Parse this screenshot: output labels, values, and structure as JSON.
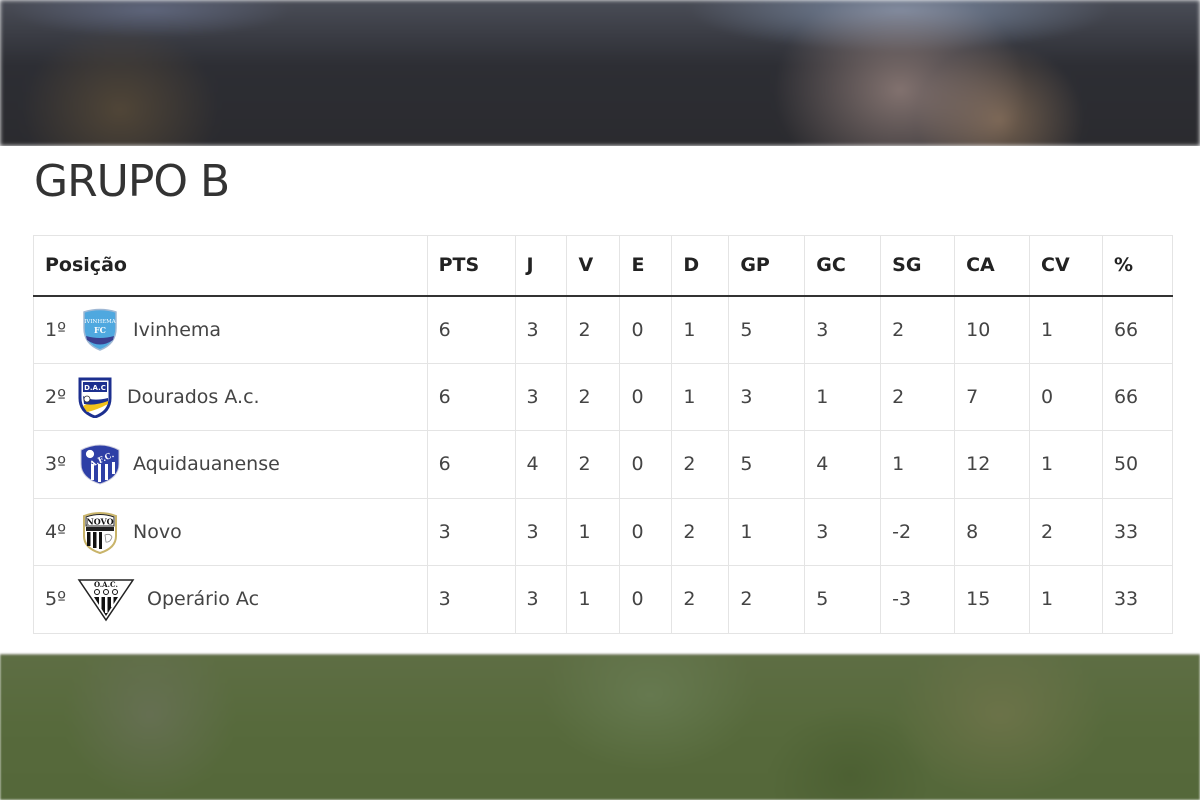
{
  "page": {
    "title": "GRUPO B"
  },
  "table": {
    "headers": [
      "Posição",
      "PTS",
      "J",
      "V",
      "E",
      "D",
      "GP",
      "GC",
      "SG",
      "CA",
      "CV",
      "%"
    ],
    "rows": [
      {
        "position": "1º",
        "crest": "ivinhema-crest-icon",
        "team": "Ivinhema",
        "pts": "6",
        "j": "3",
        "v": "2",
        "e": "0",
        "d": "1",
        "gp": "5",
        "gc": "3",
        "sg": "2",
        "ca": "10",
        "cv": "1",
        "pct": "66"
      },
      {
        "position": "2º",
        "crest": "dourados-crest-icon",
        "team": "Dourados A.c.",
        "pts": "6",
        "j": "3",
        "v": "2",
        "e": "0",
        "d": "1",
        "gp": "3",
        "gc": "1",
        "sg": "2",
        "ca": "7",
        "cv": "0",
        "pct": "66"
      },
      {
        "position": "3º",
        "crest": "aquidauanense-crest-icon",
        "team": "Aquidauanense",
        "pts": "6",
        "j": "4",
        "v": "2",
        "e": "0",
        "d": "2",
        "gp": "5",
        "gc": "4",
        "sg": "1",
        "ca": "12",
        "cv": "1",
        "pct": "50"
      },
      {
        "position": "4º",
        "crest": "novo-crest-icon",
        "team": "Novo",
        "pts": "3",
        "j": "3",
        "v": "1",
        "e": "0",
        "d": "2",
        "gp": "1",
        "gc": "3",
        "sg": "-2",
        "ca": "8",
        "cv": "2",
        "pct": "33"
      },
      {
        "position": "5º",
        "crest": "operario-crest-icon",
        "team": "Operário Ac",
        "pts": "3",
        "j": "3",
        "v": "1",
        "e": "0",
        "d": "2",
        "gp": "2",
        "gc": "5",
        "sg": "-3",
        "ca": "15",
        "cv": "1",
        "pct": "33"
      }
    ]
  },
  "crest_text": {
    "ivinhema_top": "IVINHEMA",
    "ivinhema_bottom": "FC",
    "dourados": "D.A.C",
    "aquidauanense": "A.F.C.",
    "novo": "NOVO",
    "operario": "O.A.C."
  },
  "colors": {
    "ivinhema": "#4fa8df",
    "dourados_blue": "#1c2f8f",
    "dourados_yellow": "#f2c21b",
    "aquidauanense": "#2e3fa6",
    "novo_gold": "#c9b46a"
  }
}
